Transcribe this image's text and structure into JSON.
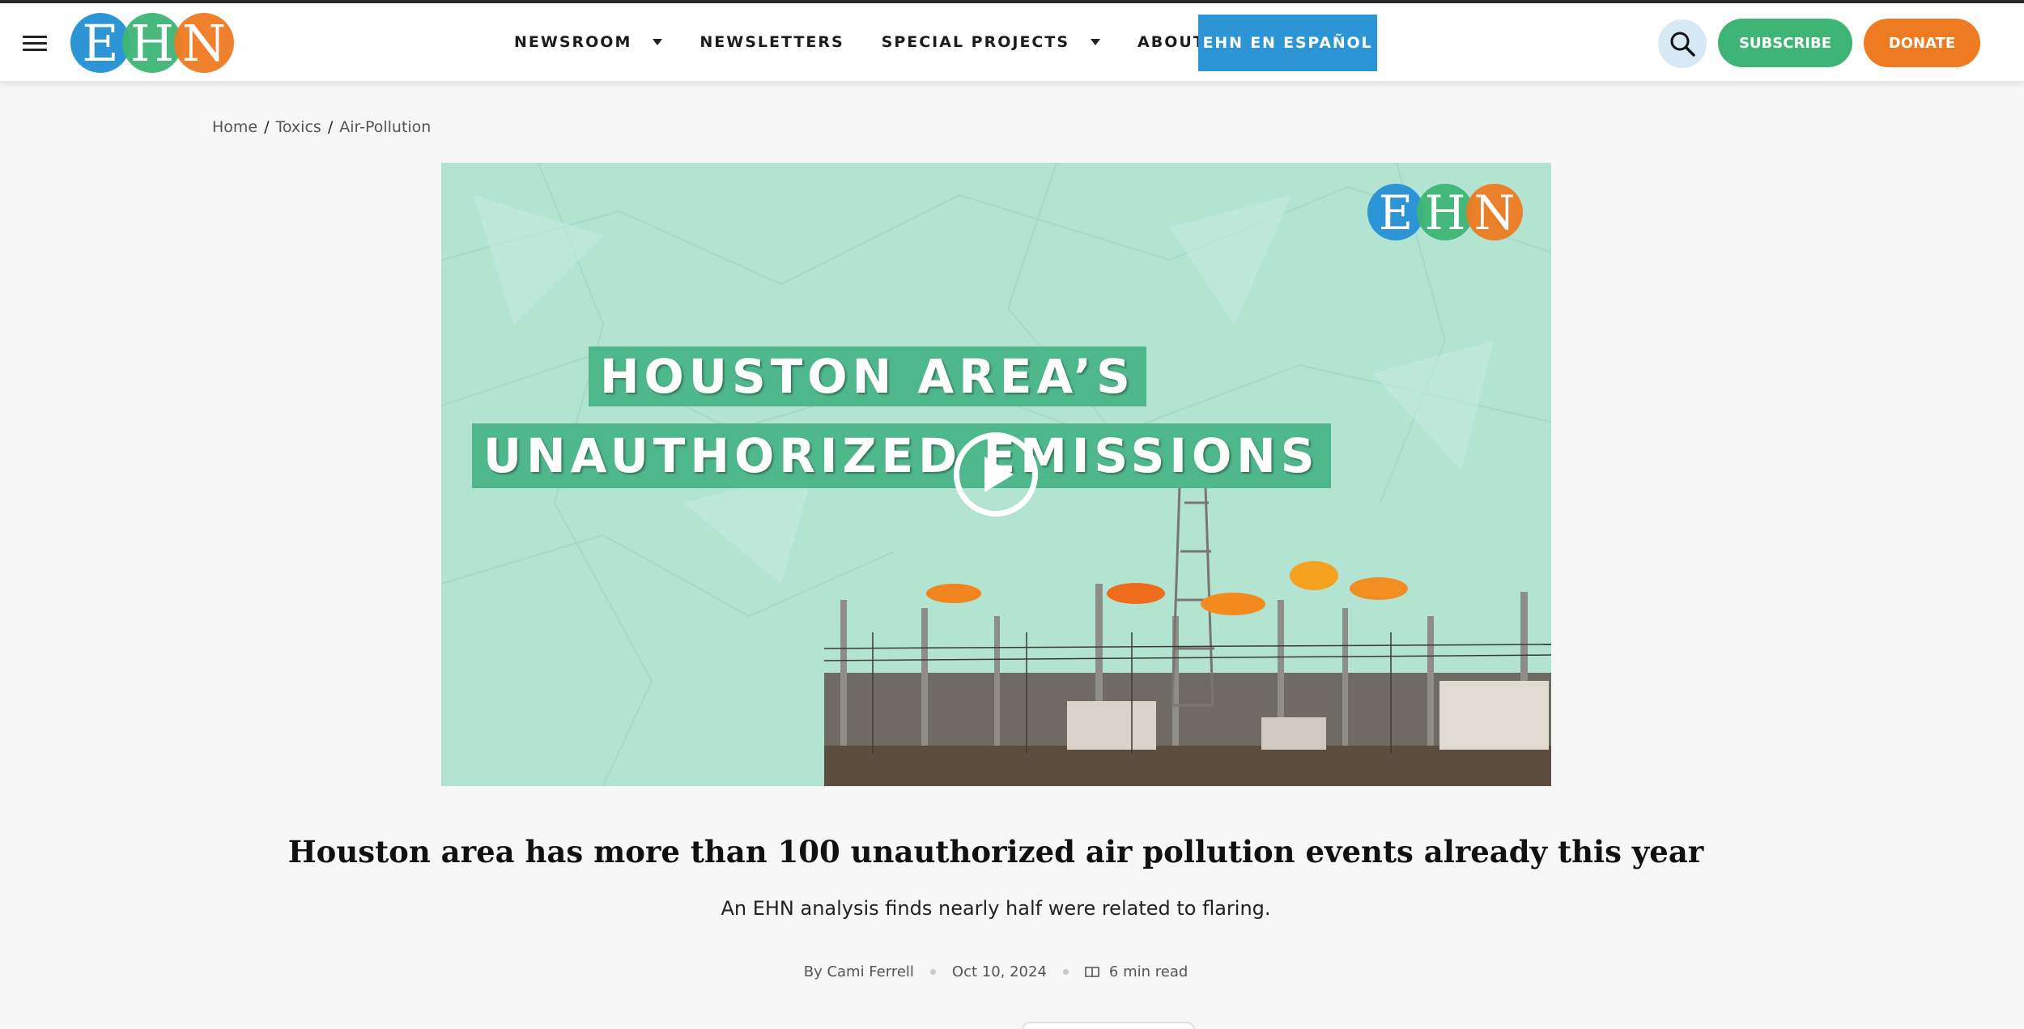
{
  "header": {
    "logo_text": "EHN",
    "nav": [
      {
        "label": "NEWSROOM",
        "has_caret": true
      },
      {
        "label": "NEWSLETTERS",
        "has_caret": false
      },
      {
        "label": "SPECIAL PROJECTS",
        "has_caret": true
      },
      {
        "label": "ABOUT US",
        "has_caret": true
      }
    ],
    "espanol_label": "EHN EN ESPAÑOL",
    "search_icon": "search-icon",
    "subscribe_label": "SUBSCRIBE",
    "donate_label": "DONATE",
    "menu_icon": "hamburger-menu-icon"
  },
  "breadcrumb": [
    {
      "label": "Home"
    },
    {
      "label": "Toxics"
    },
    {
      "label": "Air-Pollution"
    }
  ],
  "hero": {
    "title_line_1": "HOUSTON AREA’S",
    "title_line_2": "UNAUTHORIZED EMISSIONS",
    "logo_text": "EHN",
    "play_icon": "play-icon"
  },
  "article": {
    "headline": "Houston area has more than 100 unauthorized air pollution events already this year",
    "subhead": "An EHN analysis finds nearly half were related to flaring.",
    "author": "By Cami Ferrell",
    "date": "Oct 10, 2024",
    "read_time": "6 min read"
  },
  "colors": {
    "blue": "#2d95d6",
    "green": "#3eb575",
    "orange": "#ee7a22",
    "hero_bg": "#b3e4d2"
  }
}
